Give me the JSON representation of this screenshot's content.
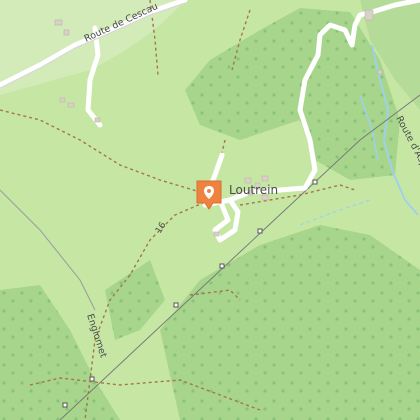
{
  "map": {
    "colors": {
      "meadow": "#c6e7a4",
      "forest": "#a6d58b",
      "road": "#ffffff",
      "path": "#a5754b",
      "water": "#9fd1ea",
      "building": "#d9d0c9",
      "marker": "#f0823f"
    },
    "labels": {
      "village": "Loutrein",
      "road_cescau": "Route de Cescau",
      "road_aspe": "Route d'Aspe",
      "trail_number": "16",
      "trail_name": "Englomet"
    },
    "marker": {
      "icon": "map-pin-icon",
      "interactable": true
    }
  }
}
